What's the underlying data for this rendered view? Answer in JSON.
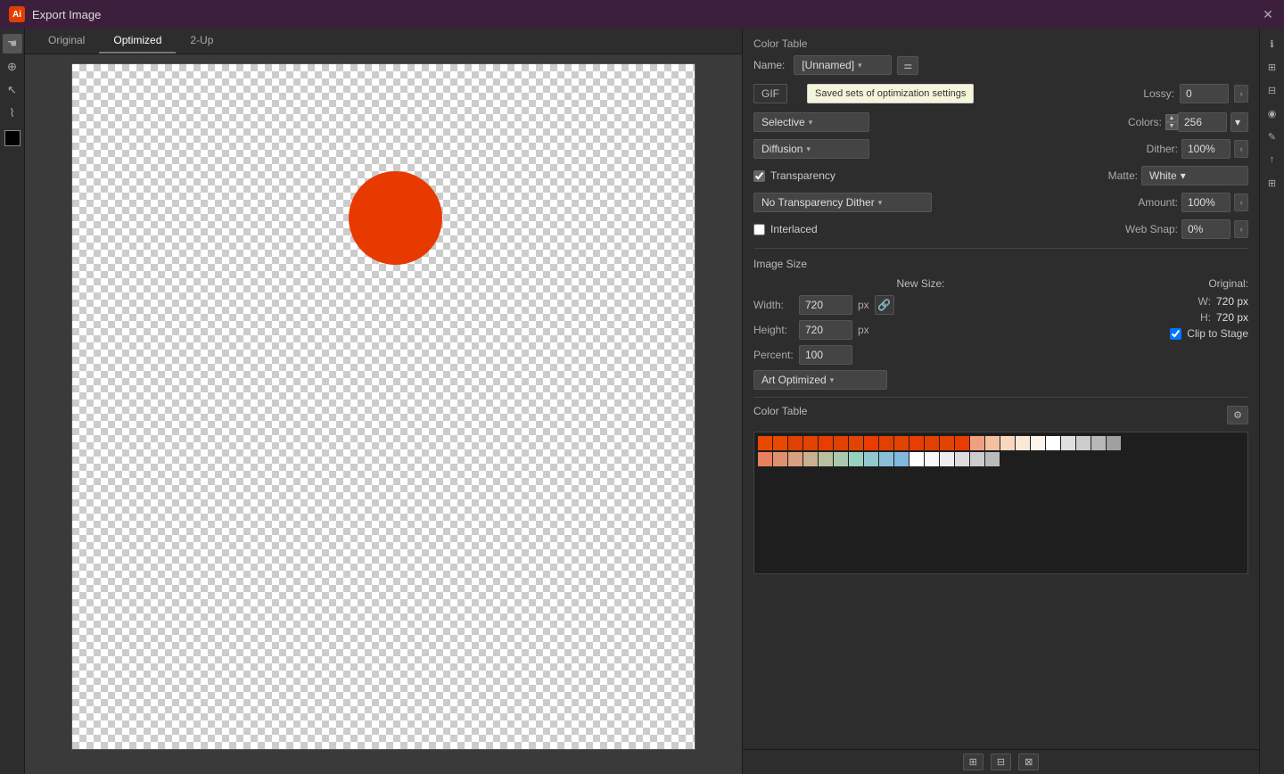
{
  "titleBar": {
    "title": "Export Image",
    "closeLabel": "✕"
  },
  "tabs": [
    {
      "label": "Original",
      "active": false
    },
    {
      "label": "Optimized",
      "active": true
    },
    {
      "label": "2-Up",
      "active": false
    }
  ],
  "preset": {
    "label": "Name:",
    "value": "[Unnamed]",
    "optionsLabel": "⚙"
  },
  "format": {
    "label": "GIF",
    "tooltipText": "Saved sets of optimization settings"
  },
  "colorMode": {
    "label": "Selective",
    "chevron": "▾"
  },
  "dither": {
    "label": "Diffusion",
    "chevron": "▾"
  },
  "transparency": {
    "label": "Transparency",
    "checked": true
  },
  "interlaced": {
    "label": "Interlaced",
    "checked": false
  },
  "transparencyDither": {
    "label": "No Transparency Dither",
    "chevron": "▾"
  },
  "lossy": {
    "label": "Lossy:",
    "value": "0",
    "arrowLabel": "›"
  },
  "colors": {
    "label": "Colors:",
    "value": "256",
    "chevron": "▾"
  },
  "dither_amount": {
    "label": "Dither:",
    "value": "100%",
    "arrowLabel": "›"
  },
  "matte": {
    "label": "Matte:",
    "value": "White",
    "chevron": "▾"
  },
  "amount": {
    "label": "Amount:",
    "value": "100%",
    "arrowLabel": "›"
  },
  "webSnap": {
    "label": "Web Snap:",
    "value": "0%",
    "arrowLabel": "›"
  },
  "imageSize": {
    "sectionLabel": "Image Size",
    "newSizeLabel": "New Size:",
    "originalLabel": "Original:",
    "widthLabel": "Width:",
    "widthValue": "720",
    "heightLabel": "Height:",
    "heightValue": "720",
    "percentLabel": "Percent:",
    "percentValue": "100",
    "unit": "px",
    "origWLabel": "W:",
    "origWValue": "720 px",
    "origHLabel": "H:",
    "origHValue": "720 px",
    "linkIcon": "🔗"
  },
  "algorithm": {
    "label": "Art Optimized",
    "chevron": "▾"
  },
  "clipToStage": {
    "label": "Clip to Stage",
    "checked": true
  },
  "colorTable": {
    "sectionLabel": "Color Table",
    "optionsLabel": "⚙"
  },
  "swatches": {
    "row1": [
      "#e84800",
      "#e84800",
      "#e04000",
      "#e04400",
      "#e83c00",
      "#e04000",
      "#e04400",
      "#e83c00",
      "#e04000",
      "#e04400",
      "#e83c00",
      "#e04000",
      "#e04400",
      "#e83c00",
      "#f0a080",
      "#f5c0a0",
      "#fad8c0",
      "#fce8d8",
      "#fdf4ec",
      "#ffffff",
      "#e0e0e0",
      "#cccccc",
      "#b8b8b8",
      "#a0a0a0"
    ],
    "row2": [
      "#e88060",
      "#e09070",
      "#d8a080",
      "#c8b090",
      "#b8c0a0",
      "#a8c8b0",
      "#98d0c0",
      "#90c8d0",
      "#88c0d8",
      "#80b8e0",
      "#ffffff",
      "#f8f8f8",
      "#eeeeee",
      "#dddddd",
      "#cccccc",
      "#bbbbbb"
    ]
  },
  "tools": {
    "hand": "✋",
    "zoom": "🔍",
    "arrow": "↖",
    "eyedropper": "💉",
    "color": "⬛"
  }
}
